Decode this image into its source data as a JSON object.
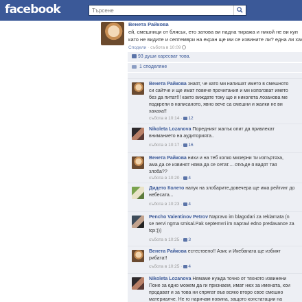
{
  "header": {
    "logo": "facebook",
    "search_placeholder": "Търсене"
  },
  "post": {
    "author": "Венета Райкова",
    "text_line1": "ей, смешници от бляськ, ето затова ви падна тиража и никой не ви куп",
    "text_line2": "като не видите и септември на екран ще ми се извините ли? една ли хаха",
    "meta_share": "Сподели",
    "meta_time": "събота в 10:09"
  },
  "likes_text": "93 души харесват това.",
  "comments_count": "1 споделяне",
  "comments": [
    {
      "author": "Венета Райкова",
      "lines": [
        "знаят, че като ми напишат името в смешното",
        "си сайтче и ще имат повече прочитания и ми използват името",
        "без да питат!!! както виждате току що и николета лозанова ме",
        "подкрепи в написаното, явно вече са смешни и жалки не ви",
        "хахаха!!"
      ],
      "time": "събота в 10:14",
      "likes": "12"
    },
    {
      "author": "Nikoleta Lozanova",
      "lines": [
        "Поредният жалък опит да привлекат",
        "вниманието на аудиторията.."
      ],
      "time": "събота в 10:17",
      "likes": "16"
    },
    {
      "author": "Венета Райкова",
      "lines": [
        "нихи и на теб колко мизерни ти изпъртяха,",
        "ама да се извинят няма да се сетат.... откъде я вадят тая",
        "злоба??"
      ],
      "time": "събота в 10:20",
      "likes": "4"
    },
    {
      "author": "Дидето Колето",
      "lines": [
        "напук на злобарите,довечера ще има рейтинг до",
        "небесата..."
      ],
      "time": "събота в 10:23",
      "likes": "4"
    },
    {
      "author": "Pencho Valentinov Petrov",
      "lines": [
        "Napravo im blagodari za reklamata (n",
        "se nervi ngma smisal.Pak septemvri im napravi edno predavance za",
        "tqx:)))"
      ],
      "time": "събота в 10:25",
      "likes": "3"
    },
    {
      "author": "Венета Райкова",
      "lines": [
        "естествено!! Азис и Икебаната ще избият",
        "рибата!!"
      ],
      "time": "събота в 10:25",
      "likes": "4"
    },
    {
      "author": "Nikoleta Lozanova",
      "lines": [
        "Нямаме нужда точно от тяхното извинени",
        "Поне за едно можем да ги признаем, имат нюх за имената, кои",
        "продават и за това ни спрягат във всяко второ свое смешно",
        "материалче. Не го наричам новина, защото констатации на"
      ],
      "time": "",
      "likes": ""
    }
  ]
}
